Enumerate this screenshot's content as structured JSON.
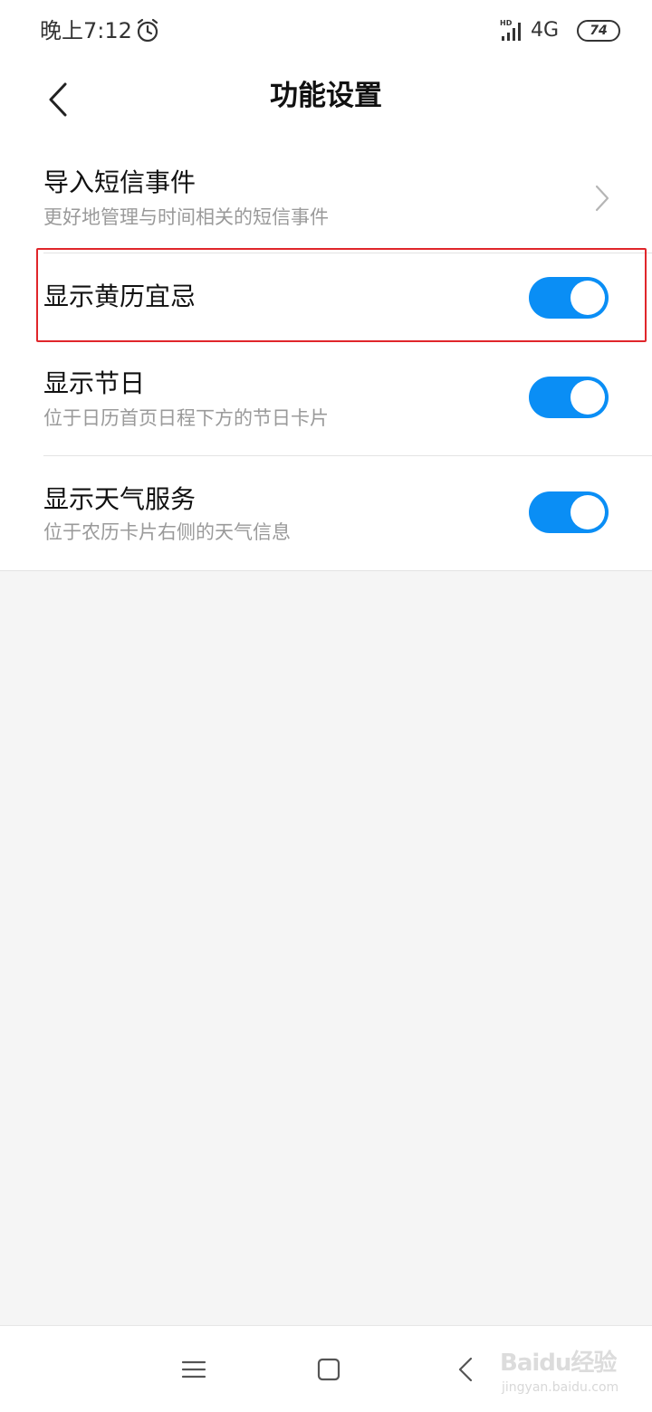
{
  "status_bar": {
    "time": "晚上7:12",
    "network": "4G",
    "battery": "74",
    "icons": [
      "alarm-icon",
      "signal-icon",
      "battery-icon"
    ]
  },
  "header": {
    "title": "功能设置",
    "back_icon": "chevron-left-icon"
  },
  "settings": [
    {
      "title": "导入短信事件",
      "subtitle": "更好地管理与时间相关的短信事件",
      "control": "chevron-right-icon"
    },
    {
      "title": "显示黄历宜忌",
      "subtitle": "",
      "control": "toggle",
      "enabled": true
    },
    {
      "title": "显示节日",
      "subtitle": "位于日历首页日程下方的节日卡片",
      "control": "toggle",
      "enabled": true
    },
    {
      "title": "显示天气服务",
      "subtitle": "位于农历卡片右侧的天气信息",
      "control": "toggle",
      "enabled": true
    }
  ],
  "colors": {
    "toggle_on": "#0a8ef5",
    "highlight": "#e0262b",
    "background": "#f5f5f5"
  },
  "nav_bar": {
    "icons": [
      "menu-icon",
      "home-square-icon",
      "back-icon"
    ]
  },
  "watermark": {
    "brand": "Baidu经验",
    "domain": "jingyan.baidu.com"
  }
}
